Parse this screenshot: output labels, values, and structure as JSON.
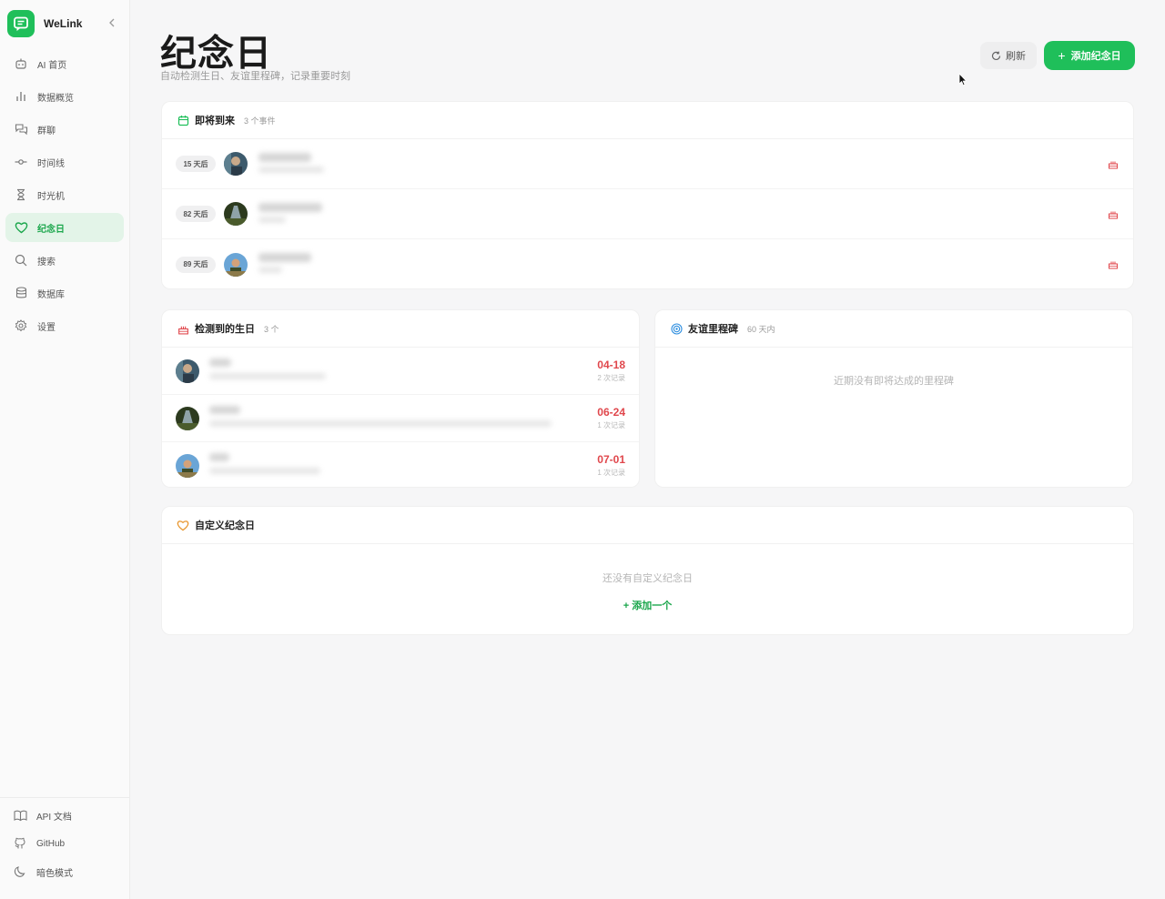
{
  "app": {
    "name": "WeLink"
  },
  "sidebar": {
    "items": [
      {
        "label": "AI 首页",
        "icon": "robot-icon"
      },
      {
        "label": "数据概览",
        "icon": "bar-chart-icon"
      },
      {
        "label": "群聊",
        "icon": "chat-bubbles-icon"
      },
      {
        "label": "时间线",
        "icon": "timeline-icon"
      },
      {
        "label": "时光机",
        "icon": "hourglass-icon"
      },
      {
        "label": "纪念日",
        "icon": "heart-icon",
        "active": true
      },
      {
        "label": "搜索",
        "icon": "search-icon"
      },
      {
        "label": "数据库",
        "icon": "database-icon"
      },
      {
        "label": "设置",
        "icon": "gear-icon"
      }
    ],
    "bottom": [
      {
        "label": "API 文档",
        "icon": "book-icon"
      },
      {
        "label": "GitHub",
        "icon": "github-icon"
      },
      {
        "label": "暗色模式",
        "icon": "moon-icon"
      }
    ]
  },
  "header": {
    "title": "纪念日",
    "subtitle": "自动检测生日、友谊里程碑，记录重要时刻",
    "refresh_label": "刷新",
    "add_label": "添加纪念日"
  },
  "upcoming": {
    "title": "即将到来",
    "meta": "3 个事件",
    "rows": [
      {
        "badge": "15 天后"
      },
      {
        "badge": "82 天后"
      },
      {
        "badge": "89 天后"
      }
    ]
  },
  "birthdays": {
    "title": "检测到的生日",
    "meta": "3 个",
    "rows": [
      {
        "date": "04-18",
        "count": "2 次记录"
      },
      {
        "date": "06-24",
        "count": "1 次记录"
      },
      {
        "date": "07-01",
        "count": "1 次记录"
      }
    ]
  },
  "milestones": {
    "title": "友谊里程碑",
    "meta": "60 天内",
    "empty": "近期没有即将达成的里程碑"
  },
  "custom": {
    "title": "自定义纪念日",
    "empty": "还没有自定义纪念日",
    "add_one": "+ 添加一个"
  },
  "colors": {
    "accent": "#1fbf5a",
    "date_red": "#e0474c",
    "active_bg": "#e3f4e8"
  }
}
